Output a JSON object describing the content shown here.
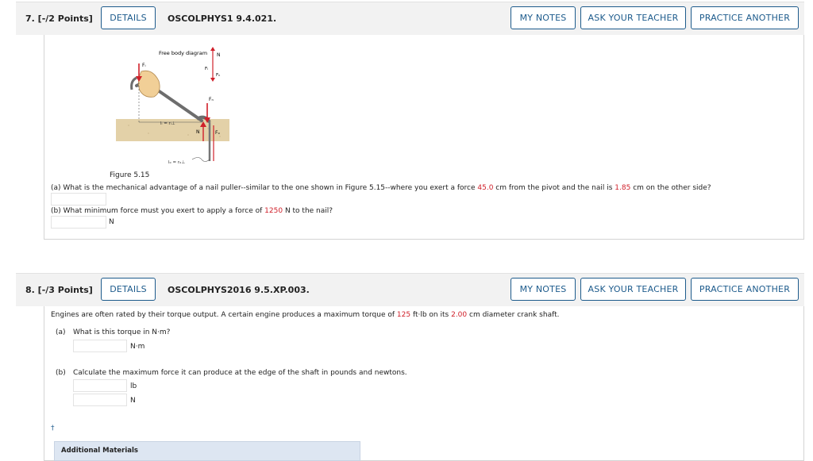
{
  "q7": {
    "number": "7.  [-/2 Points]",
    "details": "DETAILS",
    "code": "OSCOLPHYS1 9.4.021.",
    "my_notes": "MY NOTES",
    "ask_teacher": "ASK YOUR TEACHER",
    "practice": "PRACTICE ANOTHER",
    "figure": {
      "title": "Free body diagram",
      "label_N": "N",
      "label_Fi": "Fᵢ",
      "label_Fn": "Fₙ",
      "label_Fn2": "Fₙ",
      "label_N2": "N",
      "label_Fo": "Fₒ",
      "label_li": "lᵢ = rᵢ⊥",
      "label_lo": "lₒ = rₒ⊥",
      "label_Fi_hand": "Fᵢ"
    },
    "caption": "Figure 5.15",
    "part_a_pre": "(a) What is the mechanical advantage of a nail puller--similar to the one shown in Figure 5.15--where you exert a force ",
    "part_a_v1": "45.0",
    "part_a_mid": " cm from the pivot and the nail is ",
    "part_a_v2": "1.85",
    "part_a_post": " cm on the other side?",
    "part_b_pre": "(b) What minimum force must you exert to apply a force of ",
    "part_b_v1": "1250",
    "part_b_post": " N to the nail?",
    "part_b_unit": "N"
  },
  "q8": {
    "number": "8.  [-/3 Points]",
    "details": "DETAILS",
    "code": "OSCOLPHYS2016 9.5.XP.003.",
    "my_notes": "MY NOTES",
    "ask_teacher": "ASK YOUR TEACHER",
    "practice": "PRACTICE ANOTHER",
    "intro_pre": "Engines are often rated by their torque output. A certain engine produces a maximum torque of ",
    "intro_v1": "125",
    "intro_mid": " ft·lb on its ",
    "intro_v2": "2.00",
    "intro_post": " cm diameter crank shaft.",
    "part_a_label": "(a)",
    "part_a_text": "What is this torque in N·m?",
    "part_a_unit": "N·m",
    "part_b_label": "(b)",
    "part_b_text": "Calculate the maximum force it can produce at the edge of the shaft in pounds and newtons.",
    "part_b_unit1": "lb",
    "part_b_unit2": "N",
    "dagger": "†",
    "additional": "Additional Materials"
  }
}
